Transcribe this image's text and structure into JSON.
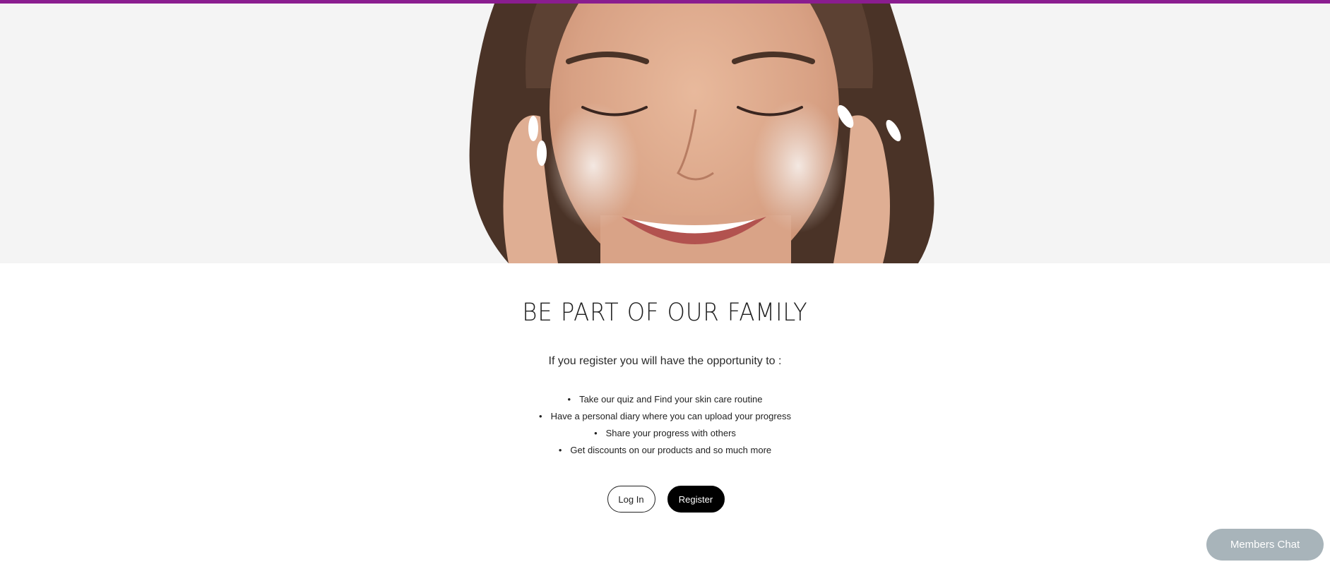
{
  "hero": {
    "image_alt": "smiling-woman-washing-face"
  },
  "section": {
    "heading": "BE PART OF OUR FAMILY",
    "intro": "If you register you will have the opportunity to :",
    "benefits": [
      "Take our quiz and Find your skin care routine",
      "Have a personal diary where you can upload your progress",
      "Share your progress with others",
      "Get discounts on our products and so much more"
    ]
  },
  "buttons": {
    "login_label": "Log In",
    "register_label": "Register"
  },
  "chat": {
    "label": "Members Chat"
  },
  "colors": {
    "accent_rule": "#8a1d8f",
    "chat_bg": "#a8b4ba",
    "hero_bg": "#f4f4f4"
  }
}
